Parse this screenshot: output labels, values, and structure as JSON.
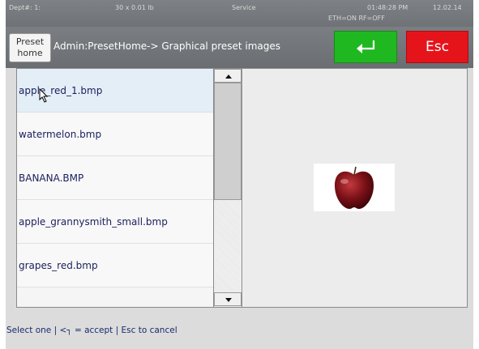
{
  "status": {
    "dept": "Dept#: 1:",
    "scale": "30 x 0.01 lb",
    "mode": "Service",
    "time": "01:48:28 PM",
    "date": "12.02.14",
    "network": "ETH=ON RF=OFF"
  },
  "header": {
    "preset_home_line1": "Preset",
    "preset_home_line2": "home",
    "title": "Admin:PresetHome-> Graphical preset images",
    "enter_icon": "enter-arrow-icon",
    "esc_label": "Esc"
  },
  "list": {
    "items": [
      {
        "label": "apple_red_1.bmp",
        "selected": true
      },
      {
        "label": "watermelon.bmp",
        "selected": false
      },
      {
        "label": "BANANA.BMP",
        "selected": false
      },
      {
        "label": "apple_grannysmith_small.bmp",
        "selected": false
      },
      {
        "label": "grapes_red.bmp",
        "selected": false
      }
    ]
  },
  "preview": {
    "image": "red-apple"
  },
  "hint": "Select one | <┐ = accept | Esc to cancel",
  "colors": {
    "enter": "#20b820",
    "esc": "#e5141b",
    "list_text": "#1a1f5c",
    "selected_row": "#e3eef7"
  }
}
